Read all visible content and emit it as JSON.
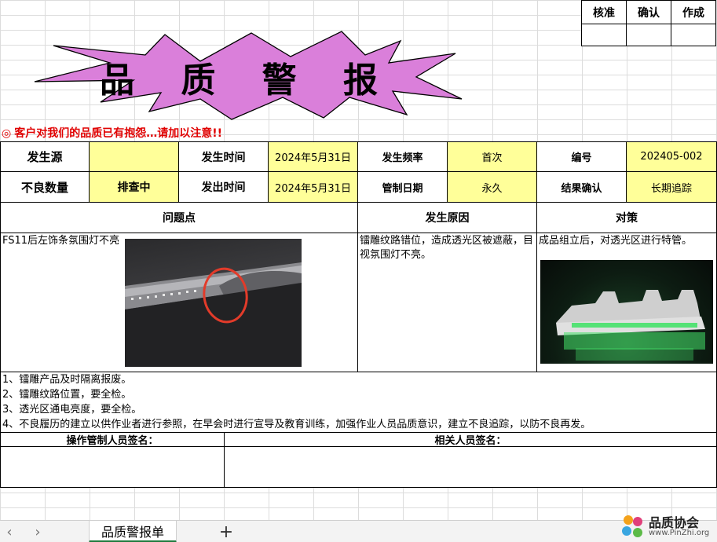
{
  "approval": {
    "headers": [
      "核准",
      "确认",
      "作成"
    ]
  },
  "title": "品 质 警 报",
  "warning": {
    "mark": "◎",
    "text": "客户对我们的品质已有抱怨…请加以注意!!"
  },
  "header": {
    "row1": [
      {
        "label": "发生源",
        "value": ""
      },
      {
        "label": "发生时间",
        "value": "2024年5月31日"
      },
      {
        "label": "发生频率",
        "value": "首次"
      },
      {
        "label": "编号",
        "value": "202405-002"
      }
    ],
    "row2": [
      {
        "label": "不良数量",
        "value": "排查中"
      },
      {
        "label": "发出时间",
        "value": "2024年5月31日"
      },
      {
        "label": "管制日期",
        "value": "永久"
      },
      {
        "label": "结果确认",
        "value": "长期追踪"
      }
    ]
  },
  "sections": {
    "problem": {
      "title": "问题点",
      "text": "FS11后左饰条氛围灯不亮"
    },
    "cause": {
      "title": "发生原因",
      "text": "镭雕纹路错位，造成透光区被遮蔽，目视氛围灯不亮。"
    },
    "action": {
      "title": "对策",
      "text": "成品组立后，对透光区进行特管。"
    }
  },
  "measures": [
    "1、镭雕产品及时隔离报废。",
    "2、镭雕纹路位置，要全检。",
    "3、透光区通电亮度，要全检。",
    "4、不良履历的建立以供作业者进行参照，在早会时进行宣导及教育训练，加强作业人员品质意识，建立不良追踪，以防不良再发。"
  ],
  "signatures": {
    "operator": "操作管制人员签名：",
    "related": "相关人员签名："
  },
  "tabbar": {
    "prev": "‹",
    "next": "›",
    "sheet_name": "品质警报单",
    "add": "+"
  },
  "watermark": {
    "name": "品质协会",
    "url": "www.PinZhi.org"
  },
  "colors": {
    "burst": "#da7fda",
    "warning": "#e00000",
    "highlight": "#ffff99"
  }
}
